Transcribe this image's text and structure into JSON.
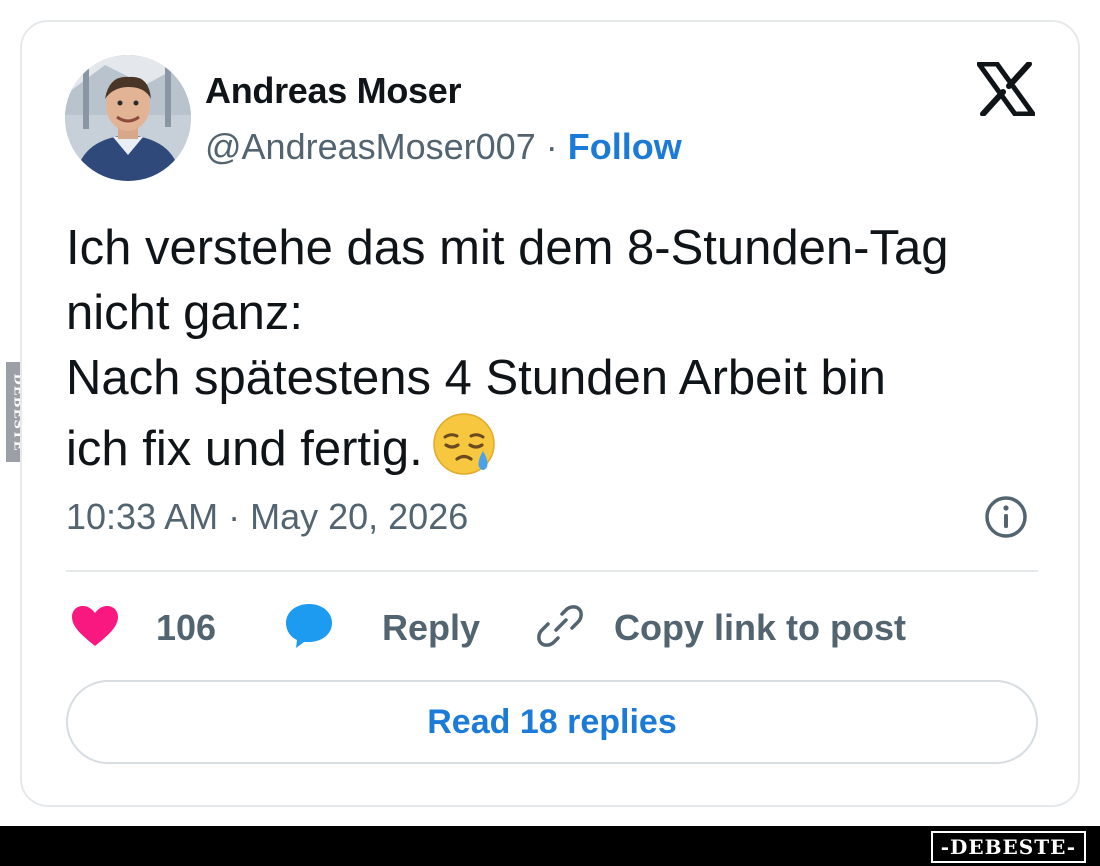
{
  "author": {
    "name": "Andreas Moser",
    "handle": "@AndreasMoser007",
    "separator": " · ",
    "follow_label": "Follow"
  },
  "tweet": {
    "lines": [
      "Ich verstehe das mit dem 8-Stunden-Tag",
      "nicht ganz:",
      "Nach spätestens 4 Stunden Arbeit bin",
      "ich fix und fertig."
    ],
    "emoji": "sleepy-face-emoji",
    "timestamp": "10:33 AM · May 20, 2026"
  },
  "actions": {
    "like_count": "106",
    "reply_label": "Reply",
    "copy_link_label": "Copy link to post"
  },
  "read_replies_label": "Read 18 replies",
  "watermark": {
    "side": "DEBESTE",
    "footer": "-DEBESTE-"
  },
  "colors": {
    "accent": "#1d7bd8",
    "like": "#f91880",
    "text_primary": "#0f1419",
    "text_secondary": "#536471",
    "border": "#e6e9ec"
  },
  "icons": [
    "x-logo-icon",
    "info-icon",
    "heart-icon",
    "reply-bubble-icon",
    "link-icon"
  ]
}
